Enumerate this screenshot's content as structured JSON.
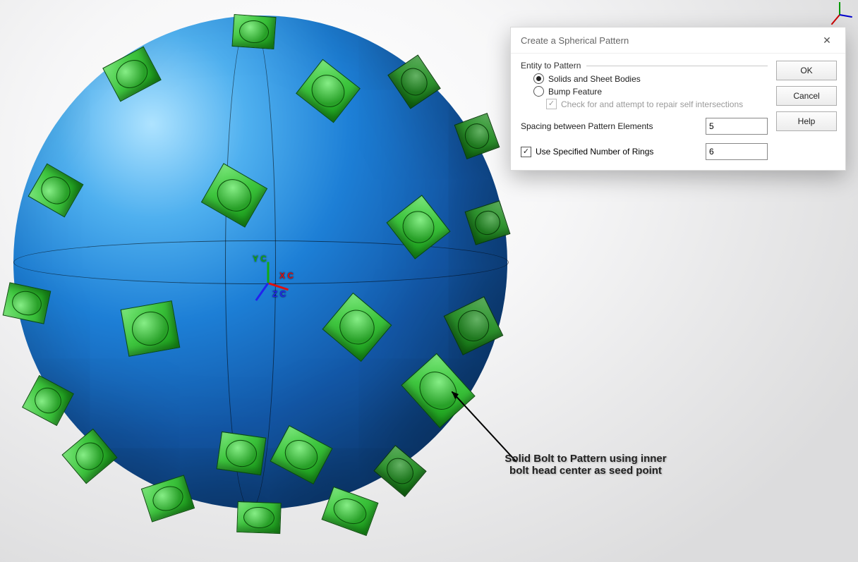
{
  "dialog": {
    "title": "Create a Spherical Pattern",
    "group_label": "Entity to Pattern",
    "radio_solids": "Solids and Sheet Bodies",
    "radio_bump": "Bump Feature",
    "check_repair": "Check for and attempt to repair self intersections",
    "spacing_label": "Spacing between Pattern Elements",
    "spacing_value": "5",
    "rings_label": "Use Specified Number of Rings",
    "rings_value": "6",
    "ok": "OK",
    "cancel": "Cancel",
    "help": "Help"
  },
  "triad": {
    "x": "X C",
    "y": "Y C",
    "z": "Z C"
  },
  "annotation": {
    "text": "Solid Bolt to Pattern using inner bolt head center as seed point"
  }
}
